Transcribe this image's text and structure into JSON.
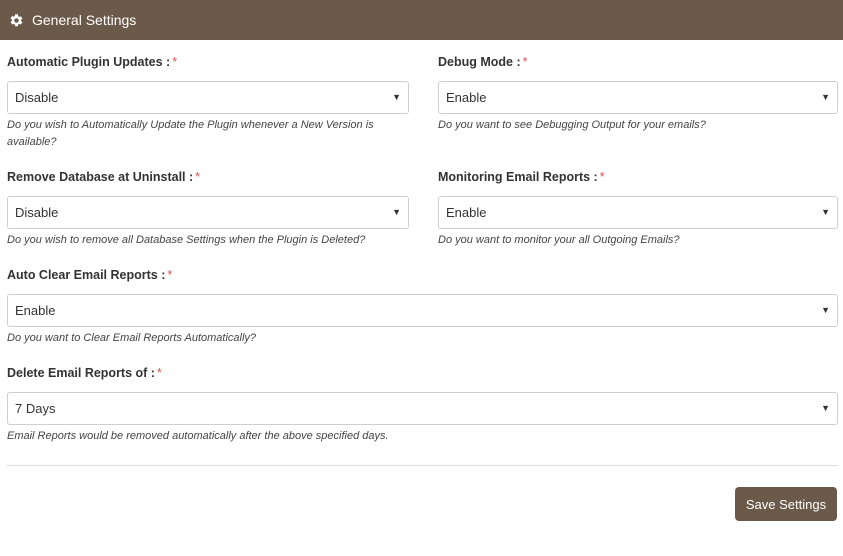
{
  "header": {
    "title": "General Settings",
    "icon": "gear-icon"
  },
  "fields": {
    "plugin_updates": {
      "label": "Automatic Plugin Updates :",
      "required": "*",
      "value": "Disable",
      "help": "Do you wish to Automatically Update the Plugin whenever a New Version is available?"
    },
    "debug_mode": {
      "label": "Debug Mode :",
      "required": "*",
      "value": "Enable",
      "help": "Do you want to see Debugging Output for your emails?"
    },
    "remove_database": {
      "label": "Remove Database at Uninstall :",
      "required": "*",
      "value": "Disable",
      "help": "Do you wish to remove all Database Settings when the Plugin is Deleted?"
    },
    "monitoring_reports": {
      "label": "Monitoring Email Reports :",
      "required": "*",
      "value": "Enable",
      "help": "Do you want to monitor your all Outgoing Emails?"
    },
    "auto_clear": {
      "label": "Auto Clear Email Reports :",
      "required": "*",
      "value": "Enable",
      "help": "Do you want to Clear Email Reports Automatically?"
    },
    "delete_reports": {
      "label": "Delete Email Reports of :",
      "required": "*",
      "value": "7 Days",
      "help": "Email Reports would be removed automatically after the above specified days."
    }
  },
  "actions": {
    "save_label": "Save Settings"
  },
  "colors": {
    "header_bg": "#6b5a49",
    "required": "#d9534f",
    "button_bg": "#6b5a49"
  }
}
